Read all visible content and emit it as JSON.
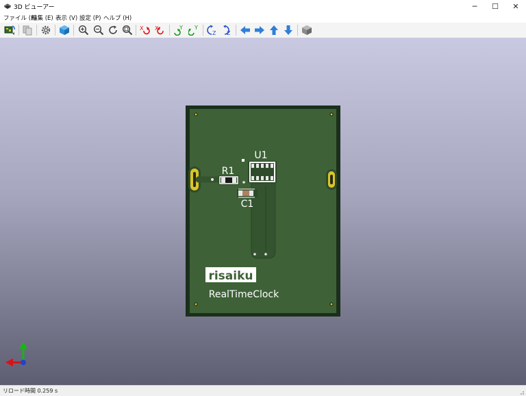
{
  "window": {
    "title": "3D ビューアー"
  },
  "window_controls": {
    "minimize": "─",
    "maximize": "☐",
    "close": "✕"
  },
  "menu": [
    {
      "label": "ファイル (F)"
    },
    {
      "label": "編集 (E)"
    },
    {
      "label": "表示 (V)"
    },
    {
      "label": "設定 (P)"
    },
    {
      "label": "ヘルプ (H)"
    }
  ],
  "toolbar": {
    "icons": [
      "reload-board-icon",
      "copy-to-clipboard-icon",
      "settings-gear-icon",
      "render-mode-cube-icon",
      "zoom-in-icon",
      "zoom-out-icon",
      "redraw-icon",
      "zoom-fit-icon",
      "rotate-x-cw-icon",
      "rotate-x-ccw-icon",
      "rotate-y-cw-icon",
      "rotate-y-ccw-icon",
      "rotate-z-cw-icon",
      "rotate-z-ccw-icon",
      "move-left-icon",
      "move-right-icon",
      "move-up-icon",
      "move-down-icon",
      "orthographic-toggle-icon"
    ],
    "glyph_labels": {
      "x": "X",
      "y": "Y",
      "z": "Z"
    }
  },
  "board": {
    "labels": {
      "u1": "U1",
      "r1": "R1",
      "c1": "C1",
      "brand": "risaiku",
      "product": "RealTimeClock"
    },
    "colors": {
      "mask": "#3e6137",
      "edge": "#1b2f1b",
      "silk": "#ffffff",
      "gold": "#d8c629",
      "copper_fill": "#34532f"
    }
  },
  "axes": {
    "colors": {
      "x": "#d8121a",
      "y": "#18b51a",
      "z": "#2244cc"
    }
  },
  "status": {
    "text": "リロード時間 0.259 s"
  }
}
